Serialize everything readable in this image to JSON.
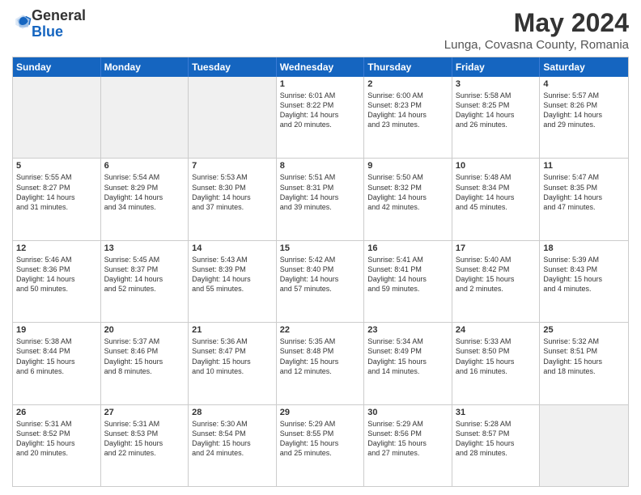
{
  "logo": {
    "general": "General",
    "blue": "Blue"
  },
  "title": "May 2024",
  "subtitle": "Lunga, Covasna County, Romania",
  "header_days": [
    "Sunday",
    "Monday",
    "Tuesday",
    "Wednesday",
    "Thursday",
    "Friday",
    "Saturday"
  ],
  "rows": [
    [
      {
        "day": "",
        "info": "",
        "shaded": true
      },
      {
        "day": "",
        "info": "",
        "shaded": true
      },
      {
        "day": "",
        "info": "",
        "shaded": true
      },
      {
        "day": "1",
        "info": "Sunrise: 6:01 AM\nSunset: 8:22 PM\nDaylight: 14 hours\nand 20 minutes."
      },
      {
        "day": "2",
        "info": "Sunrise: 6:00 AM\nSunset: 8:23 PM\nDaylight: 14 hours\nand 23 minutes."
      },
      {
        "day": "3",
        "info": "Sunrise: 5:58 AM\nSunset: 8:25 PM\nDaylight: 14 hours\nand 26 minutes."
      },
      {
        "day": "4",
        "info": "Sunrise: 5:57 AM\nSunset: 8:26 PM\nDaylight: 14 hours\nand 29 minutes."
      }
    ],
    [
      {
        "day": "5",
        "info": "Sunrise: 5:55 AM\nSunset: 8:27 PM\nDaylight: 14 hours\nand 31 minutes."
      },
      {
        "day": "6",
        "info": "Sunrise: 5:54 AM\nSunset: 8:29 PM\nDaylight: 14 hours\nand 34 minutes."
      },
      {
        "day": "7",
        "info": "Sunrise: 5:53 AM\nSunset: 8:30 PM\nDaylight: 14 hours\nand 37 minutes."
      },
      {
        "day": "8",
        "info": "Sunrise: 5:51 AM\nSunset: 8:31 PM\nDaylight: 14 hours\nand 39 minutes."
      },
      {
        "day": "9",
        "info": "Sunrise: 5:50 AM\nSunset: 8:32 PM\nDaylight: 14 hours\nand 42 minutes."
      },
      {
        "day": "10",
        "info": "Sunrise: 5:48 AM\nSunset: 8:34 PM\nDaylight: 14 hours\nand 45 minutes."
      },
      {
        "day": "11",
        "info": "Sunrise: 5:47 AM\nSunset: 8:35 PM\nDaylight: 14 hours\nand 47 minutes."
      }
    ],
    [
      {
        "day": "12",
        "info": "Sunrise: 5:46 AM\nSunset: 8:36 PM\nDaylight: 14 hours\nand 50 minutes."
      },
      {
        "day": "13",
        "info": "Sunrise: 5:45 AM\nSunset: 8:37 PM\nDaylight: 14 hours\nand 52 minutes."
      },
      {
        "day": "14",
        "info": "Sunrise: 5:43 AM\nSunset: 8:39 PM\nDaylight: 14 hours\nand 55 minutes."
      },
      {
        "day": "15",
        "info": "Sunrise: 5:42 AM\nSunset: 8:40 PM\nDaylight: 14 hours\nand 57 minutes."
      },
      {
        "day": "16",
        "info": "Sunrise: 5:41 AM\nSunset: 8:41 PM\nDaylight: 14 hours\nand 59 minutes."
      },
      {
        "day": "17",
        "info": "Sunrise: 5:40 AM\nSunset: 8:42 PM\nDaylight: 15 hours\nand 2 minutes."
      },
      {
        "day": "18",
        "info": "Sunrise: 5:39 AM\nSunset: 8:43 PM\nDaylight: 15 hours\nand 4 minutes."
      }
    ],
    [
      {
        "day": "19",
        "info": "Sunrise: 5:38 AM\nSunset: 8:44 PM\nDaylight: 15 hours\nand 6 minutes."
      },
      {
        "day": "20",
        "info": "Sunrise: 5:37 AM\nSunset: 8:46 PM\nDaylight: 15 hours\nand 8 minutes."
      },
      {
        "day": "21",
        "info": "Sunrise: 5:36 AM\nSunset: 8:47 PM\nDaylight: 15 hours\nand 10 minutes."
      },
      {
        "day": "22",
        "info": "Sunrise: 5:35 AM\nSunset: 8:48 PM\nDaylight: 15 hours\nand 12 minutes."
      },
      {
        "day": "23",
        "info": "Sunrise: 5:34 AM\nSunset: 8:49 PM\nDaylight: 15 hours\nand 14 minutes."
      },
      {
        "day": "24",
        "info": "Sunrise: 5:33 AM\nSunset: 8:50 PM\nDaylight: 15 hours\nand 16 minutes."
      },
      {
        "day": "25",
        "info": "Sunrise: 5:32 AM\nSunset: 8:51 PM\nDaylight: 15 hours\nand 18 minutes."
      }
    ],
    [
      {
        "day": "26",
        "info": "Sunrise: 5:31 AM\nSunset: 8:52 PM\nDaylight: 15 hours\nand 20 minutes."
      },
      {
        "day": "27",
        "info": "Sunrise: 5:31 AM\nSunset: 8:53 PM\nDaylight: 15 hours\nand 22 minutes."
      },
      {
        "day": "28",
        "info": "Sunrise: 5:30 AM\nSunset: 8:54 PM\nDaylight: 15 hours\nand 24 minutes."
      },
      {
        "day": "29",
        "info": "Sunrise: 5:29 AM\nSunset: 8:55 PM\nDaylight: 15 hours\nand 25 minutes."
      },
      {
        "day": "30",
        "info": "Sunrise: 5:29 AM\nSunset: 8:56 PM\nDaylight: 15 hours\nand 27 minutes."
      },
      {
        "day": "31",
        "info": "Sunrise: 5:28 AM\nSunset: 8:57 PM\nDaylight: 15 hours\nand 28 minutes."
      },
      {
        "day": "",
        "info": "",
        "shaded": true
      }
    ]
  ]
}
